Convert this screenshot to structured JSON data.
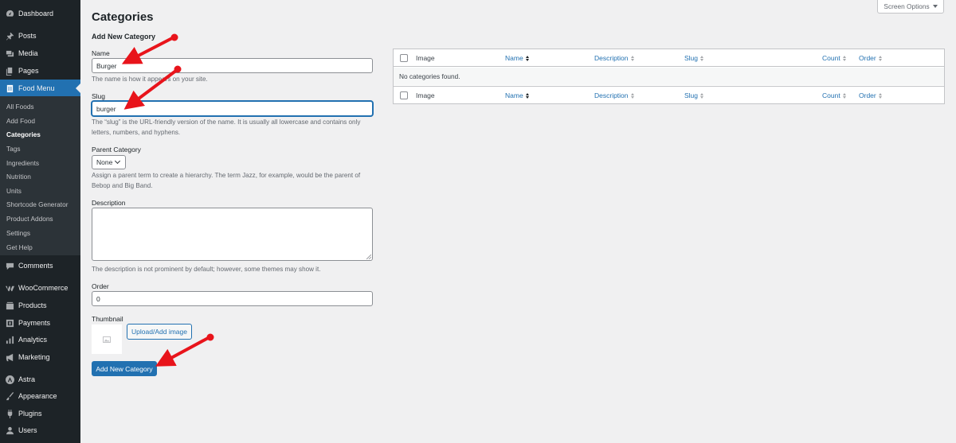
{
  "sidebar": {
    "items": [
      {
        "label": "Dashboard",
        "icon": "dashboard-icon"
      },
      {
        "label": "Posts",
        "icon": "pin-icon"
      },
      {
        "label": "Media",
        "icon": "media-icon"
      },
      {
        "label": "Pages",
        "icon": "pages-icon"
      },
      {
        "label": "Food Menu",
        "icon": "food-menu-icon"
      },
      {
        "label": "Comments",
        "icon": "comment-icon"
      },
      {
        "label": "WooCommerce",
        "icon": "woocommerce-icon"
      },
      {
        "label": "Products",
        "icon": "products-icon"
      },
      {
        "label": "Payments",
        "icon": "payments-icon"
      },
      {
        "label": "Analytics",
        "icon": "analytics-icon"
      },
      {
        "label": "Marketing",
        "icon": "megaphone-icon"
      },
      {
        "label": "Astra",
        "icon": "astra-icon"
      },
      {
        "label": "Appearance",
        "icon": "brush-icon"
      },
      {
        "label": "Plugins",
        "icon": "plug-icon"
      },
      {
        "label": "Users",
        "icon": "user-icon"
      }
    ],
    "submenu": [
      "All Foods",
      "Add Food",
      "Categories",
      "Tags",
      "Ingredients",
      "Nutrition",
      "Units",
      "Shortcode Generator",
      "Product Addons",
      "Settings",
      "Get Help"
    ]
  },
  "header": {
    "screen_options": "Screen Options",
    "title": "Categories"
  },
  "form": {
    "title": "Add New Category",
    "name_label": "Name",
    "name_value": "Burger",
    "name_help": "The name is how it appears on your site.",
    "slug_label": "Slug",
    "slug_value": "burger",
    "slug_help": "The “slug” is the URL-friendly version of the name. It is usually all lowercase and contains only letters, numbers, and hyphens.",
    "parent_label": "Parent Category",
    "parent_value": "None",
    "parent_help": "Assign a parent term to create a hierarchy. The term Jazz, for example, would be the parent of Bebop and Big Band.",
    "description_label": "Description",
    "description_help": "The description is not prominent by default; however, some themes may show it.",
    "order_label": "Order",
    "order_value": "0",
    "thumbnail_label": "Thumbnail",
    "upload_label": "Upload/Add image",
    "submit_label": "Add New Category"
  },
  "table": {
    "columns": [
      "Image",
      "Name",
      "Description",
      "Slug",
      "Count",
      "Order"
    ],
    "empty_message": "No categories found."
  },
  "colors": {
    "sidebar_bg": "#1d2327",
    "submenu_bg": "#2c3338",
    "accent": "#2271b1",
    "annotation_arrow": "#e8141b"
  }
}
